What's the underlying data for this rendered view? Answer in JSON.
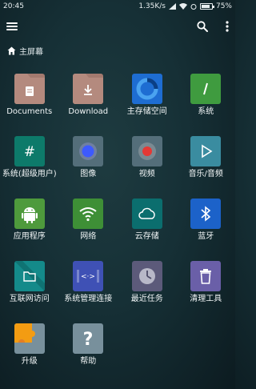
{
  "status_bar": {
    "time": "20:45",
    "speed": "1.35K/s",
    "battery": "75%",
    "battery_level": 0.75
  },
  "toolbar": {
    "menu_icon": "hamburger-menu-icon",
    "search_icon": "search-icon",
    "more_icon": "more-vert-icon"
  },
  "breadcrumb": {
    "home_icon": "home-icon",
    "label": "主屏幕"
  },
  "tiles": [
    {
      "label": "Documents",
      "icon": "documents-folder-icon",
      "color": "#b48a7e"
    },
    {
      "label": "Download",
      "icon": "download-folder-icon",
      "color": "#b48a7e"
    },
    {
      "label": "主存储空间",
      "icon": "storage-pie-icon",
      "color": "#1e6dd2"
    },
    {
      "label": "系统",
      "icon": "system-slash-icon",
      "color": "#3f9b3f"
    },
    {
      "label": "系统(超级用户)",
      "icon": "root-hash-icon",
      "color": "#0d7a6a"
    },
    {
      "label": "图像",
      "icon": "image-circle-icon",
      "color": "#546e7a"
    },
    {
      "label": "视频",
      "icon": "video-record-icon",
      "color": "#546e7a"
    },
    {
      "label": "音乐/音频",
      "icon": "audio-play-icon",
      "color": "#3a8ca0"
    },
    {
      "label": "应用程序",
      "icon": "android-icon",
      "color": "#4e9a3c"
    },
    {
      "label": "网络",
      "icon": "wifi-icon",
      "color": "#3e8f36"
    },
    {
      "label": "云存储",
      "icon": "cloud-icon",
      "color": "#0b6e6e"
    },
    {
      "label": "蓝牙",
      "icon": "bluetooth-icon",
      "color": "#1c62c9"
    },
    {
      "label": "互联网访问",
      "icon": "internet-folder-icon",
      "color": "#148a8a"
    },
    {
      "label": "系统管理连接",
      "icon": "connection-arrows-icon",
      "color": "#3f51b5"
    },
    {
      "label": "最近任务",
      "icon": "clock-icon",
      "color": "#5c5a7a"
    },
    {
      "label": "清理工具",
      "icon": "trash-icon",
      "color": "#6a5fa8"
    },
    {
      "label": "升级",
      "icon": "upgrade-puzzle-icon",
      "color": "#f39c12"
    },
    {
      "label": "帮助",
      "icon": "help-question-icon",
      "color": "#78909c"
    }
  ]
}
